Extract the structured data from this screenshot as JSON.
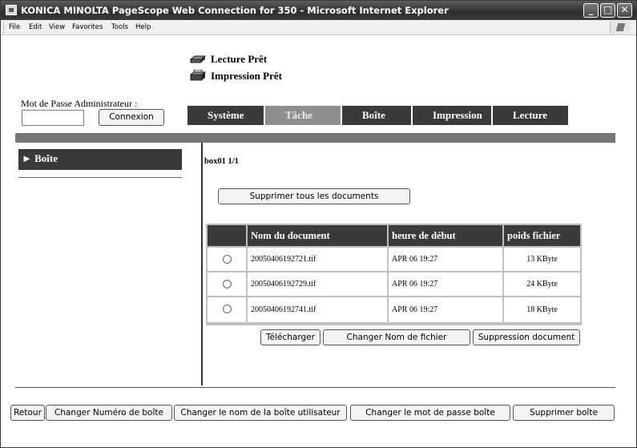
{
  "window": {
    "title": "KONICA MINOLTA PageScope Web Connection for 350 - Microsoft Internet Explorer",
    "controls": {
      "minimize": "_",
      "maximize": "□",
      "close": "✕"
    }
  },
  "menu": [
    "File",
    "Edit",
    "View",
    "Favorites",
    "Tools",
    "Help"
  ],
  "status": [
    {
      "icon": "scanner-icon",
      "text": "Lecture Prêt"
    },
    {
      "icon": "printer-icon",
      "text": "Impression Prêt"
    }
  ],
  "admin": {
    "label": "Mot de Passe Administrateur :",
    "password_value": "",
    "connect_button": "Connexion"
  },
  "tabs": [
    {
      "label": "Système",
      "style": "dark"
    },
    {
      "label": "Tâche",
      "style": "light"
    },
    {
      "label": "Boîte",
      "style": "dark"
    },
    {
      "label": "Impression",
      "style": "dark"
    },
    {
      "label": "Lecture",
      "style": "dark"
    }
  ],
  "sidebar": {
    "items": [
      {
        "label": "► Boîte"
      }
    ]
  },
  "main": {
    "box_label": "box01  1/1",
    "delete_all_button": "Supprimer tous les documents",
    "table": {
      "headers": [
        "",
        "Nom du document",
        "heure de début",
        "poids fichier"
      ],
      "rows": [
        {
          "name": "20050406192721.tif",
          "time": "APR 06 19:27",
          "size": "13 KByte"
        },
        {
          "name": "20050406192729.tif",
          "time": "APR 06 19:27",
          "size": "24 KByte"
        },
        {
          "name": "20050406192741.tif",
          "time": "APR 06 19:27",
          "size": "18 KByte"
        }
      ]
    },
    "actions": {
      "download": "Télécharger",
      "rename": "Changer Nom de fichier",
      "delete_doc": "Suppression document"
    }
  },
  "bottom_buttons": {
    "back": "Retour",
    "change_box_number": "Changer Numéro de boîte",
    "change_user_box_name": "Changer le nom de la boîte utilisateur",
    "change_box_password": "Changer le mot de passe boîte",
    "delete_box": "Supprimer boîte"
  }
}
